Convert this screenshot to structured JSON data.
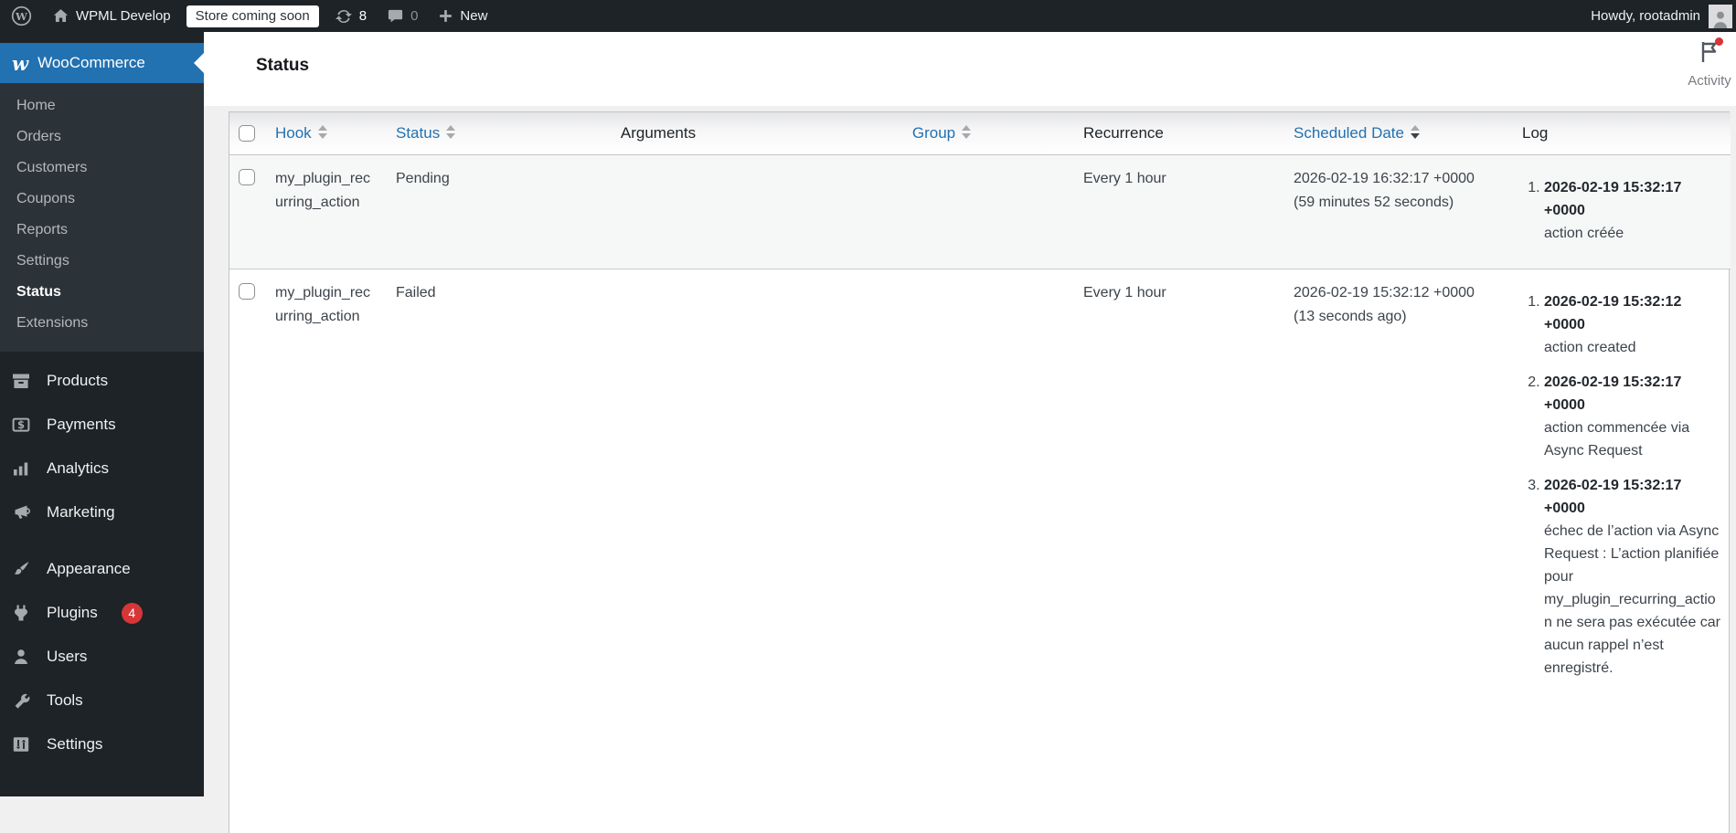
{
  "colors": {
    "accent": "#2271b1",
    "badge": "#d63638",
    "adminbar_bg": "#1d2327",
    "submenu_bg": "#2c3338"
  },
  "admin_bar": {
    "site_name": "WPML Develop",
    "coming_soon_label": "Store coming soon",
    "updates_count": "8",
    "comments_count": "0",
    "new_label": "New",
    "howdy": "Howdy, rootadmin",
    "icons": [
      "wordpress-logo-icon",
      "home-icon",
      "updates-icon",
      "comments-icon",
      "plus-icon",
      "avatar"
    ]
  },
  "sidebar": {
    "brand_label": "WooCommerce",
    "brand_icon": "woocommerce-logo-icon",
    "submenu": [
      {
        "label": "Home",
        "current": false
      },
      {
        "label": "Orders",
        "current": false
      },
      {
        "label": "Customers",
        "current": false
      },
      {
        "label": "Coupons",
        "current": false
      },
      {
        "label": "Reports",
        "current": false
      },
      {
        "label": "Settings",
        "current": false
      },
      {
        "label": "Status",
        "current": true
      },
      {
        "label": "Extensions",
        "current": false
      }
    ],
    "menu": [
      {
        "label": "Products",
        "icon": "products-box-icon"
      },
      {
        "label": "Payments",
        "icon": "payments-icon"
      },
      {
        "label": "Analytics",
        "icon": "analytics-icon"
      },
      {
        "label": "Marketing",
        "icon": "marketing-icon"
      },
      {
        "separator": true
      },
      {
        "label": "Appearance",
        "icon": "appearance-icon"
      },
      {
        "label": "Plugins",
        "icon": "plugins-icon",
        "badge": "4"
      },
      {
        "label": "Users",
        "icon": "users-icon"
      },
      {
        "label": "Tools",
        "icon": "tools-icon"
      },
      {
        "label": "Settings",
        "icon": "settings-icon"
      }
    ]
  },
  "header": {
    "title": "Status",
    "activity_label": "Activity",
    "activity_icon": "flag-icon"
  },
  "table": {
    "columns": [
      {
        "key": "cb",
        "label": "",
        "sortable": false
      },
      {
        "key": "hook",
        "label": "Hook",
        "sortable": true
      },
      {
        "key": "status",
        "label": "Status",
        "sortable": true
      },
      {
        "key": "arguments",
        "label": "Arguments",
        "sortable": false,
        "align": "center"
      },
      {
        "key": "group",
        "label": "Group",
        "sortable": true,
        "align": "center"
      },
      {
        "key": "recurrence",
        "label": "Recurrence",
        "sortable": false
      },
      {
        "key": "scheduled",
        "label": "Scheduled Date",
        "sortable": true,
        "sorted": "desc"
      },
      {
        "key": "log",
        "label": "Log",
        "sortable": false
      }
    ],
    "rows": [
      {
        "hook": "my_plugin_recurring_action",
        "status": "Pending",
        "arguments": "",
        "group": "",
        "recurrence": "Every 1 hour",
        "scheduled_datetime": "2026-02-19 16:32:17 +0000",
        "scheduled_relative": "(59 minutes 52 seconds)",
        "logs": [
          {
            "timestamp": "2026-02-19 15:32:17 +0000",
            "message": "action créée"
          }
        ]
      },
      {
        "hook": "my_plugin_recurring_action",
        "status": "Failed",
        "arguments": "",
        "group": "",
        "recurrence": "Every 1 hour",
        "scheduled_datetime": "2026-02-19 15:32:12 +0000",
        "scheduled_relative": "(13 seconds ago)",
        "logs": [
          {
            "timestamp": "2026-02-19 15:32:12 +0000",
            "message": "action created"
          },
          {
            "timestamp": "2026-02-19 15:32:17 +0000",
            "message": "action commencée via Async Request"
          },
          {
            "timestamp": "2026-02-19 15:32:17 +0000",
            "message": "échec de l’action via Async Request : L’action planifiée pour my_plugin_recurring_action ne sera pas exécutée car aucun rappel n’est enregistré."
          }
        ]
      }
    ]
  }
}
